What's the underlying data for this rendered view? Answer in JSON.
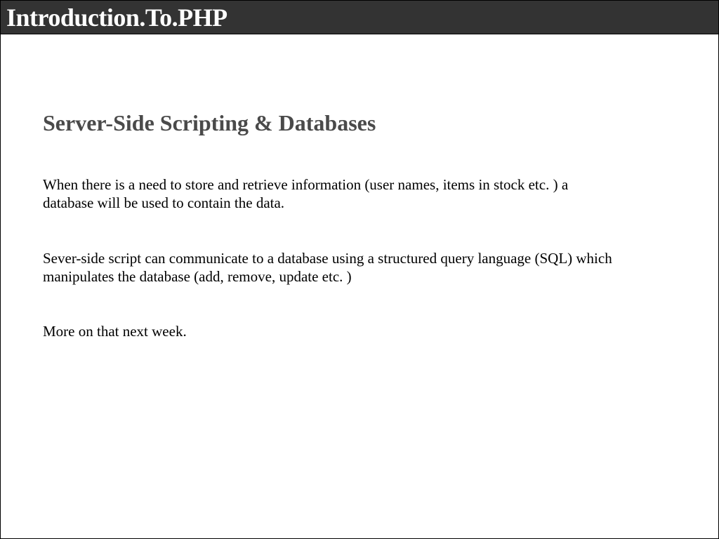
{
  "header": {
    "title": "Introduction.To.PHP"
  },
  "slide": {
    "heading": "Server-Side Scripting & Databases",
    "paragraphs": [
      "When there is a need to store and retrieve information (user names, items in stock etc. ) a database will be used to contain the data.",
      "Sever-side script can communicate to a database using a structured query language (SQL) which manipulates the database (add, remove, update etc. )",
      "More on that next week."
    ]
  }
}
